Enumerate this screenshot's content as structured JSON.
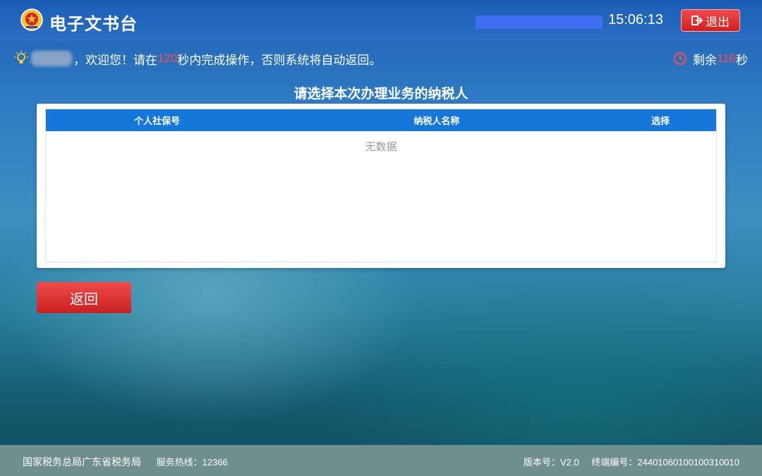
{
  "header": {
    "app_title": "电子文书台",
    "time": "15:06:13",
    "logout_label": "退出"
  },
  "notice": {
    "welcome_prefix": "，欢迎您！请在",
    "seconds_total": "120",
    "welcome_suffix": "秒内完成操作，否则系统将自动返回。",
    "remaining_prefix": "剩余",
    "remaining_value": "116",
    "remaining_suffix": "秒"
  },
  "main": {
    "section_title": "请选择本次办理业务的纳税人",
    "table": {
      "columns": [
        "个人社保号",
        "纳税人名称",
        "选择"
      ],
      "empty_text": "无数据"
    },
    "back_button_label": "返回"
  },
  "footer": {
    "org_name": "国家税务总局广东省税务局",
    "hotline": "服务热线：12366",
    "version": "版本号：V2.0",
    "terminal": "终端编号：24401060100100310010"
  },
  "colors": {
    "accent_blue": "#1477d9",
    "button_red": "#d11f1f",
    "highlight_red": "#ff4b4b"
  },
  "icons": {
    "logo": "tax-emblem-icon",
    "logout": "logout-icon",
    "notice": "lightbulb-icon",
    "timer": "clock-icon"
  }
}
